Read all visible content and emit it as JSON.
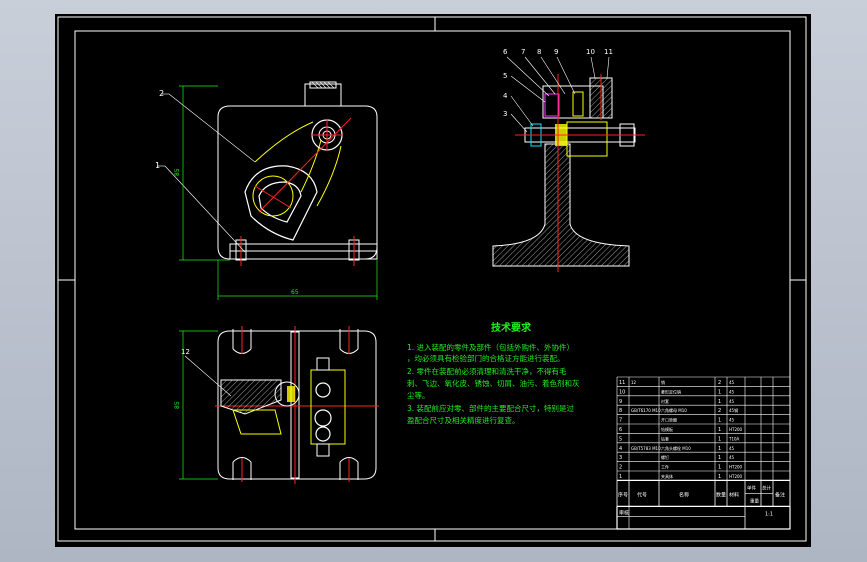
{
  "view": {
    "background": "#000000",
    "line_color": "#ffffff",
    "accent_colors": [
      "#22ee22",
      "#ffff00",
      "#ff2222",
      "#00e5ff",
      "#ff33ff"
    ]
  },
  "front_view": {
    "callouts": [
      "2",
      "1"
    ],
    "width_dim": "65",
    "height_dim": "85"
  },
  "side_view": {
    "callouts_top": [
      "6",
      "7",
      "8",
      "9",
      "10",
      "11"
    ],
    "callouts_left": [
      "5",
      "4",
      "3"
    ]
  },
  "plan_view": {
    "callout": "12",
    "height_dim": "85"
  },
  "tech_req": {
    "title": "技术要求",
    "lines": [
      "1. 进入装配的零件及部件（包括外购件、外协件）",
      "，均必须具有检验部门的合格证方能进行装配。",
      "2. 零件在装配前必须清理和清洗干净，不得有毛",
      "刺、飞边、氧化皮、锈蚀、切屑、油污、着色剂和灰",
      "尘等。",
      "3. 装配前应对零、部件的主要配合尺寸，特别是过",
      "盈配合尺寸及相关精度进行复查。"
    ]
  },
  "bom": {
    "rows": [
      {
        "no": "11",
        "code": "12",
        "name": "销",
        "qty": "2",
        "mat": "45"
      },
      {
        "no": "10",
        "code": "",
        "name": "菱形定位销",
        "qty": "1",
        "mat": "45"
      },
      {
        "no": "9",
        "code": "",
        "name": "衬套",
        "qty": "1",
        "mat": "45"
      },
      {
        "no": "8",
        "code": "GB/T6170 M10",
        "name": "六角螺母 M10",
        "qty": "2",
        "mat": "45钢"
      },
      {
        "no": "7",
        "code": "",
        "name": "开口垫圈",
        "qty": "1",
        "mat": "45"
      },
      {
        "no": "6",
        "code": "",
        "name": "钻模板",
        "qty": "1",
        "mat": "HT200"
      },
      {
        "no": "5",
        "code": "",
        "name": "钻套",
        "qty": "1",
        "mat": "T10A"
      },
      {
        "no": "4",
        "code": "GB/T5783 M10",
        "name": "六角头螺栓 M10",
        "qty": "1",
        "mat": "45"
      },
      {
        "no": "3",
        "code": "",
        "name": "螺钉",
        "qty": "1",
        "mat": "45"
      },
      {
        "no": "2",
        "code": "",
        "name": "工件",
        "qty": "1",
        "mat": "HT200"
      },
      {
        "no": "1",
        "code": "",
        "name": "夹具体",
        "qty": "1",
        "mat": "HT200"
      }
    ],
    "header": {
      "no": "序号",
      "code": "代号",
      "name": "名称",
      "qty": "数量",
      "mat": "材料",
      "unit_wt": "单件",
      "tot_wt": "总计",
      "weight": "重量",
      "note": "备注"
    },
    "title_row": {
      "left": "审核",
      "scale": "1:1"
    }
  }
}
